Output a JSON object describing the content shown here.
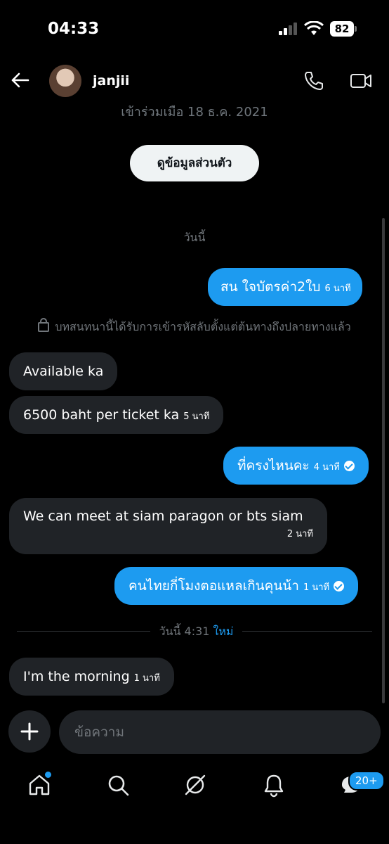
{
  "status_bar": {
    "time": "04:33",
    "battery": "82"
  },
  "header": {
    "username": "janjii",
    "joined": "เข้าร่วมเมือ 18 ธ.ค. 2021",
    "profile_button": "ดูข้อมูลส่วนตัว"
  },
  "day_label": "วันนี้",
  "encryption_notice": "บทสนทนานี้ได้รับการเข้ารหัสลับตั้งแต่ต้นทางถึงปลายทางแล้ว",
  "messages": [
    {
      "text": "สน ใจบัตรค่า2ใบ",
      "time": "6 นาที"
    },
    {
      "text": "Available ka",
      "time": ""
    },
    {
      "text": "6500 baht per ticket ka",
      "time": "5 นาที"
    },
    {
      "text": "ที่ครงไหนคะ",
      "time": "4 นาที"
    },
    {
      "text": "We can meet at siam paragon or bts siam",
      "time": "2 นาที"
    },
    {
      "text": "คนไทยกี่โมงตอแหลเกินคุนน้า",
      "time": "1 นาที"
    },
    {
      "text": "I'm the morning",
      "time": "1 นาที"
    }
  ],
  "new_divider": {
    "time": "วันนี้ 4:31",
    "new_label": "ใหม่"
  },
  "composer": {
    "placeholder": "ข้อความ"
  },
  "tabbar": {
    "messages_badge": "20+"
  },
  "colors": {
    "accent": "#1d9bf0",
    "received_bubble": "#202327",
    "background": "#000000"
  },
  "icons": [
    "back-arrow-icon",
    "phone-icon",
    "video-camera-icon",
    "lock-icon",
    "plus-icon",
    "home-icon",
    "search-icon",
    "grok-icon",
    "bell-icon",
    "messages-icon",
    "check-icon"
  ]
}
